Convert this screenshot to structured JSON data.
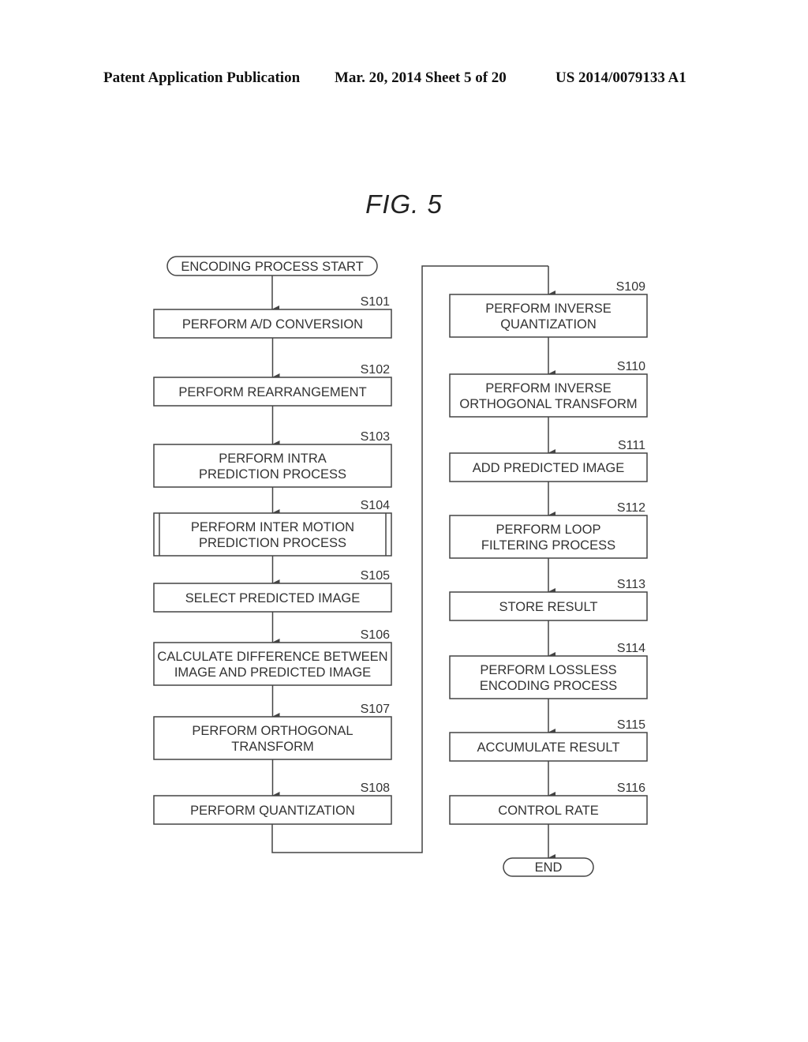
{
  "header": {
    "publication": "Patent Application Publication",
    "date_sheet": "Mar. 20, 2014  Sheet 5 of 20",
    "patent_number": "US 2014/0079133 A1"
  },
  "figure": {
    "title": "FIG. 5"
  },
  "flowchart": {
    "start": "ENCODING PROCESS START",
    "end": "END",
    "steps": [
      {
        "id": "S101",
        "lines": [
          "PERFORM A/D CONVERSION"
        ],
        "shape": "process"
      },
      {
        "id": "S102",
        "lines": [
          "PERFORM REARRANGEMENT"
        ],
        "shape": "process"
      },
      {
        "id": "S103",
        "lines": [
          "PERFORM INTRA",
          "PREDICTION PROCESS"
        ],
        "shape": "process"
      },
      {
        "id": "S104",
        "lines": [
          "PERFORM INTER MOTION",
          "PREDICTION PROCESS"
        ],
        "shape": "predefined-process"
      },
      {
        "id": "S105",
        "lines": [
          "SELECT PREDICTED IMAGE"
        ],
        "shape": "process"
      },
      {
        "id": "S106",
        "lines": [
          "CALCULATE DIFFERENCE BETWEEN",
          "IMAGE AND PREDICTED IMAGE"
        ],
        "shape": "process"
      },
      {
        "id": "S107",
        "lines": [
          "PERFORM ORTHOGONAL",
          "TRANSFORM"
        ],
        "shape": "process"
      },
      {
        "id": "S108",
        "lines": [
          "PERFORM QUANTIZATION"
        ],
        "shape": "process"
      },
      {
        "id": "S109",
        "lines": [
          "PERFORM INVERSE",
          "QUANTIZATION"
        ],
        "shape": "process"
      },
      {
        "id": "S110",
        "lines": [
          "PERFORM INVERSE",
          "ORTHOGONAL TRANSFORM"
        ],
        "shape": "process"
      },
      {
        "id": "S111",
        "lines": [
          "ADD PREDICTED IMAGE"
        ],
        "shape": "process"
      },
      {
        "id": "S112",
        "lines": [
          "PERFORM LOOP",
          "FILTERING PROCESS"
        ],
        "shape": "process"
      },
      {
        "id": "S113",
        "lines": [
          "STORE RESULT"
        ],
        "shape": "process"
      },
      {
        "id": "S114",
        "lines": [
          "PERFORM LOSSLESS",
          "ENCODING PROCESS"
        ],
        "shape": "process"
      },
      {
        "id": "S115",
        "lines": [
          "ACCUMULATE RESULT"
        ],
        "shape": "process"
      },
      {
        "id": "S116",
        "lines": [
          "CONTROL RATE"
        ],
        "shape": "process"
      }
    ]
  }
}
